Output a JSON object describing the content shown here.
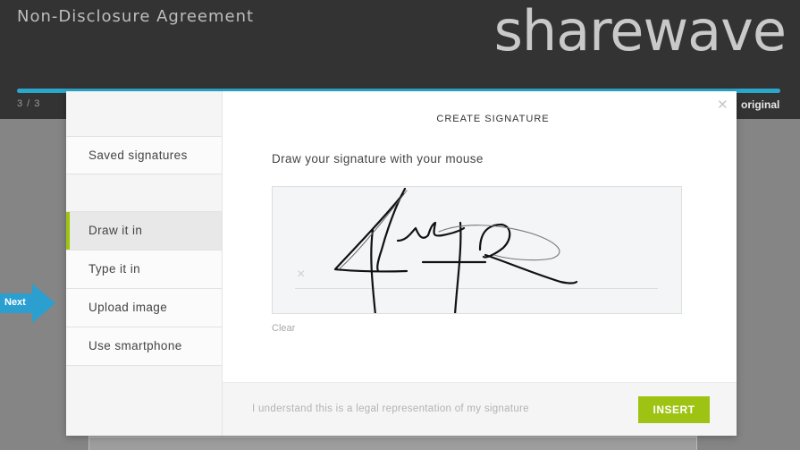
{
  "header": {
    "document_title": "Non-Disclosure Agreement",
    "brand": "sharewave",
    "step_counter": "3 / 3",
    "progress": 1.0,
    "original_link": "original"
  },
  "next_arrow": {
    "label": "Next"
  },
  "modal": {
    "title": "CREATE SIGNATURE",
    "close_icon": "close-icon",
    "sidebar": {
      "saved": "Saved signatures",
      "items": [
        {
          "label": "Draw it in",
          "active": true
        },
        {
          "label": "Type it in",
          "active": false
        },
        {
          "label": "Upload image",
          "active": false
        },
        {
          "label": "Use smartphone",
          "active": false
        }
      ]
    },
    "instruction": "Draw your signature with your mouse",
    "canvas": {
      "x_marker": "×"
    },
    "clear_label": "Clear",
    "footer": {
      "legal_text": "I understand this is a legal representation of my signature",
      "insert_label": "INSERT"
    }
  },
  "colors": {
    "accent_green": "#9ec312",
    "progress_blue": "#2aa8cc",
    "header_bg": "#333333"
  }
}
